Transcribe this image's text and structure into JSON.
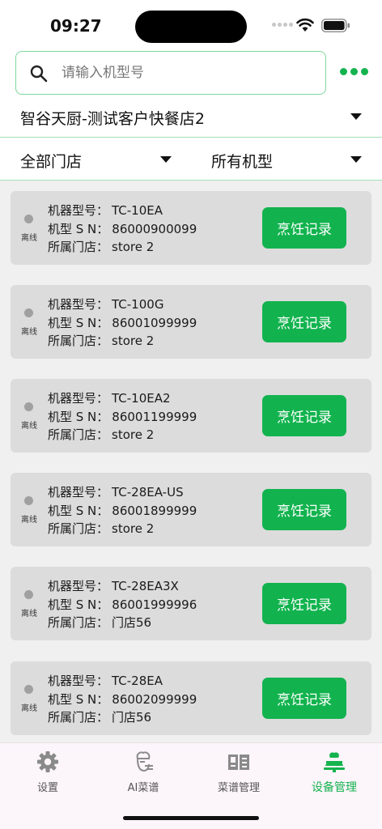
{
  "status_bar": {
    "time": "09:27"
  },
  "search": {
    "placeholder": "请输入机型号",
    "value": ""
  },
  "store": {
    "name": "智谷天厨-测试客户快餐店2"
  },
  "filters": {
    "store": "全部门店",
    "model": "所有机型"
  },
  "labels": {
    "model": "机器型号：",
    "sn": "机型 S N：",
    "store": "所属门店：",
    "button": "烹饪记录"
  },
  "devices": [
    {
      "status": "离线",
      "model": "TC-10EA",
      "sn": "86000900099",
      "store": "store 2"
    },
    {
      "status": "离线",
      "model": "TC-100G",
      "sn": "86001099999",
      "store": "store 2"
    },
    {
      "status": "离线",
      "model": "TC-10EA2",
      "sn": "86001199999",
      "store": "store 2"
    },
    {
      "status": "离线",
      "model": "TC-28EA-US",
      "sn": "86001899999",
      "store": "store 2"
    },
    {
      "status": "离线",
      "model": "TC-28EA3X",
      "sn": "86001999996",
      "store": "门店56"
    },
    {
      "status": "离线",
      "model": "TC-28EA",
      "sn": "86002099999",
      "store": "门店56"
    }
  ],
  "tabs": [
    {
      "label": "设置",
      "icon": "gear-icon"
    },
    {
      "label": "AI菜谱",
      "icon": "ai-chef-icon"
    },
    {
      "label": "菜谱管理",
      "icon": "recipe-book-icon"
    },
    {
      "label": "设备管理",
      "icon": "device-chef-icon"
    }
  ],
  "colors": {
    "accent": "#15b34f",
    "offline_dot": "#a0a0a0"
  }
}
